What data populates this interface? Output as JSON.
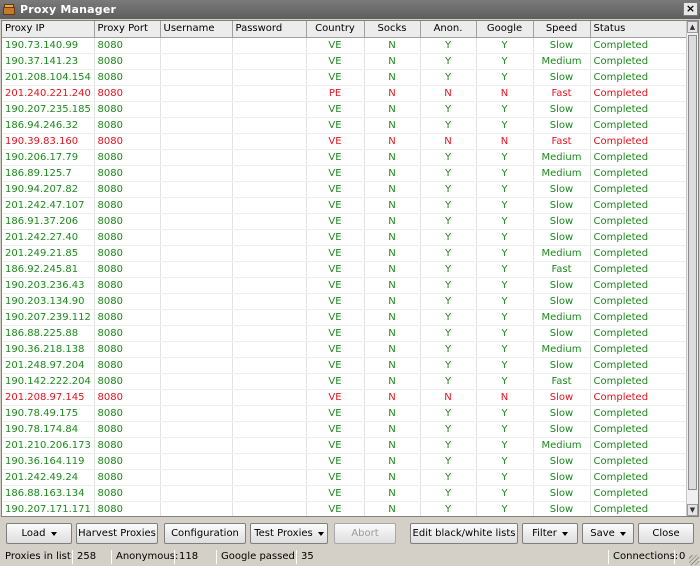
{
  "window": {
    "title": "Proxy Manager",
    "close_label": "×"
  },
  "columns": [
    "Proxy IP",
    "Proxy Port",
    "Username",
    "Password",
    "Country",
    "Socks",
    "Anon.",
    "Google",
    "Speed",
    "Status"
  ],
  "rows": [
    [
      "190.73.140.99",
      "8080",
      "",
      "",
      "VE",
      "N",
      "Y",
      "Y",
      "Slow",
      "Completed"
    ],
    [
      "190.37.141.23",
      "8080",
      "",
      "",
      "VE",
      "N",
      "Y",
      "Y",
      "Medium",
      "Completed"
    ],
    [
      "201.208.104.154",
      "8080",
      "",
      "",
      "VE",
      "N",
      "Y",
      "Y",
      "Slow",
      "Completed"
    ],
    [
      "201.240.221.240",
      "8080",
      "",
      "",
      "PE",
      "N",
      "N",
      "N",
      "Fast",
      "Completed"
    ],
    [
      "190.207.235.185",
      "8080",
      "",
      "",
      "VE",
      "N",
      "Y",
      "Y",
      "Slow",
      "Completed"
    ],
    [
      "186.94.246.32",
      "8080",
      "",
      "",
      "VE",
      "N",
      "Y",
      "Y",
      "Slow",
      "Completed"
    ],
    [
      "190.39.83.160",
      "8080",
      "",
      "",
      "VE",
      "N",
      "N",
      "N",
      "Fast",
      "Completed"
    ],
    [
      "190.206.17.79",
      "8080",
      "",
      "",
      "VE",
      "N",
      "Y",
      "Y",
      "Medium",
      "Completed"
    ],
    [
      "186.89.125.7",
      "8080",
      "",
      "",
      "VE",
      "N",
      "Y",
      "Y",
      "Medium",
      "Completed"
    ],
    [
      "190.94.207.82",
      "8080",
      "",
      "",
      "VE",
      "N",
      "Y",
      "Y",
      "Slow",
      "Completed"
    ],
    [
      "201.242.47.107",
      "8080",
      "",
      "",
      "VE",
      "N",
      "Y",
      "Y",
      "Slow",
      "Completed"
    ],
    [
      "186.91.37.206",
      "8080",
      "",
      "",
      "VE",
      "N",
      "Y",
      "Y",
      "Slow",
      "Completed"
    ],
    [
      "201.242.27.40",
      "8080",
      "",
      "",
      "VE",
      "N",
      "Y",
      "Y",
      "Slow",
      "Completed"
    ],
    [
      "201.249.21.85",
      "8080",
      "",
      "",
      "VE",
      "N",
      "Y",
      "Y",
      "Medium",
      "Completed"
    ],
    [
      "186.92.245.81",
      "8080",
      "",
      "",
      "VE",
      "N",
      "Y",
      "Y",
      "Fast",
      "Completed"
    ],
    [
      "190.203.236.43",
      "8080",
      "",
      "",
      "VE",
      "N",
      "Y",
      "Y",
      "Slow",
      "Completed"
    ],
    [
      "190.203.134.90",
      "8080",
      "",
      "",
      "VE",
      "N",
      "Y",
      "Y",
      "Slow",
      "Completed"
    ],
    [
      "190.207.239.112",
      "8080",
      "",
      "",
      "VE",
      "N",
      "Y",
      "Y",
      "Medium",
      "Completed"
    ],
    [
      "186.88.225.88",
      "8080",
      "",
      "",
      "VE",
      "N",
      "Y",
      "Y",
      "Slow",
      "Completed"
    ],
    [
      "190.36.218.138",
      "8080",
      "",
      "",
      "VE",
      "N",
      "Y",
      "Y",
      "Medium",
      "Completed"
    ],
    [
      "201.248.97.204",
      "8080",
      "",
      "",
      "VE",
      "N",
      "Y",
      "Y",
      "Slow",
      "Completed"
    ],
    [
      "190.142.222.204",
      "8080",
      "",
      "",
      "VE",
      "N",
      "Y",
      "Y",
      "Fast",
      "Completed"
    ],
    [
      "201.208.97.145",
      "8080",
      "",
      "",
      "VE",
      "N",
      "N",
      "N",
      "Slow",
      "Completed"
    ],
    [
      "190.78.49.175",
      "8080",
      "",
      "",
      "VE",
      "N",
      "Y",
      "Y",
      "Slow",
      "Completed"
    ],
    [
      "190.78.174.84",
      "8080",
      "",
      "",
      "VE",
      "N",
      "Y",
      "Y",
      "Slow",
      "Completed"
    ],
    [
      "201.210.206.173",
      "8080",
      "",
      "",
      "VE",
      "N",
      "Y",
      "Y",
      "Medium",
      "Completed"
    ],
    [
      "190.36.164.119",
      "8080",
      "",
      "",
      "VE",
      "N",
      "Y",
      "Y",
      "Slow",
      "Completed"
    ],
    [
      "201.242.49.24",
      "8080",
      "",
      "",
      "VE",
      "N",
      "Y",
      "Y",
      "Slow",
      "Completed"
    ],
    [
      "186.88.163.134",
      "8080",
      "",
      "",
      "VE",
      "N",
      "Y",
      "Y",
      "Slow",
      "Completed"
    ],
    [
      "190.207.171.171",
      "8080",
      "",
      "",
      "VE",
      "N",
      "Y",
      "Y",
      "Slow",
      "Completed"
    ]
  ],
  "row_status": [
    "good",
    "good",
    "good",
    "bad",
    "good",
    "good",
    "bad",
    "good",
    "good",
    "good",
    "good",
    "good",
    "good",
    "good",
    "good",
    "good",
    "good",
    "good",
    "good",
    "good",
    "good",
    "good",
    "bad",
    "good",
    "good",
    "good",
    "good",
    "good",
    "good",
    "good"
  ],
  "colors": {
    "good": "#1a8a1a",
    "bad": "#e0141c"
  },
  "toolbar": {
    "load": "Load",
    "harvest": "Harvest Proxies",
    "configuration": "Configuration",
    "test": "Test Proxies",
    "abort": "Abort",
    "edit_lists": "Edit black/white lists",
    "filter": "Filter",
    "save": "Save",
    "close": "Close"
  },
  "status": {
    "proxies_label": "Proxies in list:",
    "proxies_value": "258",
    "anonymous_label": "Anonymous:",
    "anonymous_value": "118",
    "google_label": "Google passed:",
    "google_value": "35",
    "connections_label": "Connections:",
    "connections_value": "0"
  }
}
